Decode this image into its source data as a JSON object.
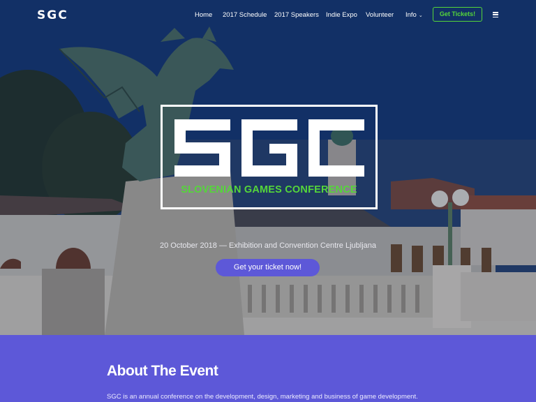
{
  "nav": {
    "logo": "SGC",
    "items": [
      {
        "label": "Home"
      },
      {
        "label": "2017 Schedule"
      },
      {
        "label": "2017 Speakers"
      },
      {
        "label": "Indie Expo"
      },
      {
        "label": "Volunteer"
      },
      {
        "label": "Info"
      }
    ],
    "cta": "Get Tickets!",
    "menu_icon": "hamburger-icon"
  },
  "hero": {
    "logo_letters": "SGC",
    "subtitle": "SLOVENIAN GAMES CONFERENCE",
    "info": "20 October 2018 — Exhibition and Convention Centre Ljubljana",
    "button": "Get your ticket now!"
  },
  "about": {
    "title": "About The Event",
    "text": "SGC is an annual conference on the development, design, marketing and business of game development."
  },
  "colors": {
    "accent_green": "#55d63a",
    "brand_purple": "#5d58d8",
    "white": "#ffffff"
  }
}
